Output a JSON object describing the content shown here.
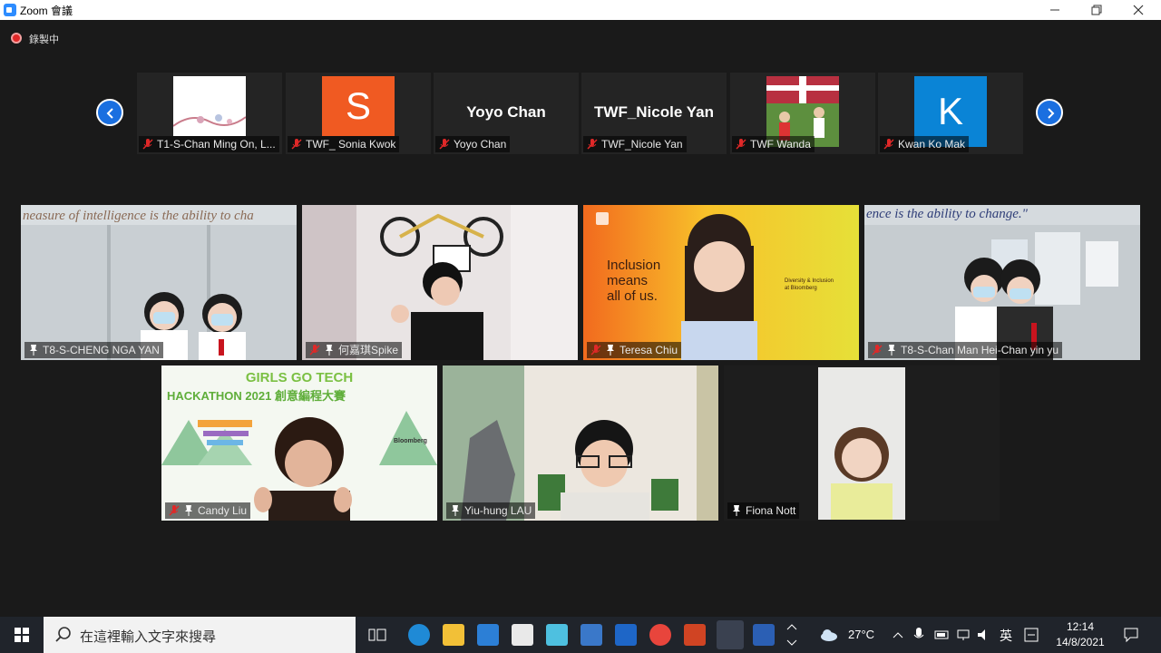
{
  "window": {
    "title": "Zoom 會議",
    "minimize": "—",
    "maximize": "❐",
    "close": "✕"
  },
  "recording": {
    "label": "錄製中"
  },
  "strip": [
    {
      "name": "T1-S-Chan Ming On, L...",
      "muted": true
    },
    {
      "name": "TWF_ Sonia Kwok",
      "initial": "S",
      "avatar_color": "#f05a22",
      "muted": true
    },
    {
      "name": "Yoyo Chan",
      "display": "Yoyo Chan",
      "muted": true
    },
    {
      "name": "TWF_Nicole Yan",
      "display": "TWF_Nicole Yan",
      "muted": true
    },
    {
      "name": "TWF Wanda",
      "muted": true
    },
    {
      "name": "Kwan Ko Mak",
      "initial": "K",
      "avatar_color": "#0a84d6",
      "muted": true
    }
  ],
  "gallery": [
    {
      "name": "T8-S-CHENG NGA YAN",
      "muted": false,
      "pinned": true,
      "banner": "neasure of intelligence is the ability to cha"
    },
    {
      "name": "何嘉琪Spike",
      "muted": true,
      "pinned": true
    },
    {
      "name": "Teresa Chiu",
      "muted": true,
      "pinned": true,
      "poster_line1": "Inclusion",
      "poster_line2": "means",
      "poster_line3": "all of us.",
      "poster_small1": "Diversity & Inclusion",
      "poster_small2": "at Bloomberg"
    },
    {
      "name": "T8-S-Chan Man Hei-Chan yin yu",
      "muted": true,
      "pinned": true,
      "banner": "ence is the ability to change.\""
    },
    {
      "name": "Candy Liu",
      "muted": true,
      "pinned": true,
      "bg_title1": "GIRLS GO TECH",
      "bg_title2": "HACKATHON 2021 創意編程大賽",
      "bg_brand": "Bloomberg"
    },
    {
      "name": "Yiu-hung LAU",
      "muted": false,
      "pinned": true
    },
    {
      "name": "Fiona Nott",
      "muted": false,
      "pinned": true
    }
  ],
  "taskbar": {
    "search_placeholder": "在這裡輸入文字來搜尋",
    "weather": "27°C",
    "ime": "英",
    "time": "12:14",
    "date": "14/8/2021"
  },
  "colors": {
    "accent": "#2d8cff",
    "nav": "#1a6fe0",
    "muted_icon": "#e02828"
  }
}
